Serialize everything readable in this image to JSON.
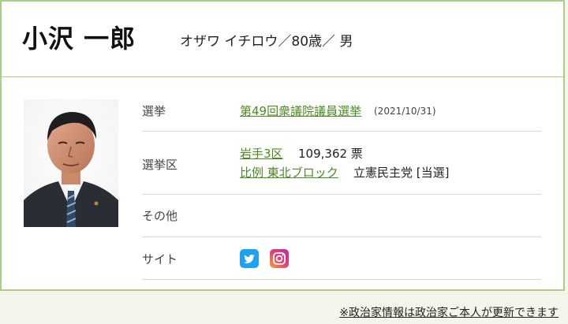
{
  "profile": {
    "name": "小沢 一郎",
    "kana_age_gender": "オザワ イチロウ／80歳／ 男"
  },
  "details": {
    "election": {
      "label": "選挙",
      "link_text": "第49回衆議院議員選挙",
      "date": "(2021/10/31)"
    },
    "district": {
      "label": "選挙区",
      "district_link": "岩手3区",
      "votes": "109,362 票",
      "pr_link": "比例 東北ブロック",
      "party_result": "立憲民主党 [当選]"
    },
    "other": {
      "label": "その他"
    },
    "site": {
      "label": "サイト",
      "icons": [
        "twitter-icon",
        "instagram-icon"
      ]
    }
  },
  "footer": {
    "note": "※政治家情報は政治家ご本人が更新できます"
  },
  "colors": {
    "accent_border": "#a9cf87",
    "link": "#4c8a22",
    "twitter": "#1da1f2",
    "instagram_start": "#f9a13b",
    "instagram_end": "#b52fb5"
  }
}
